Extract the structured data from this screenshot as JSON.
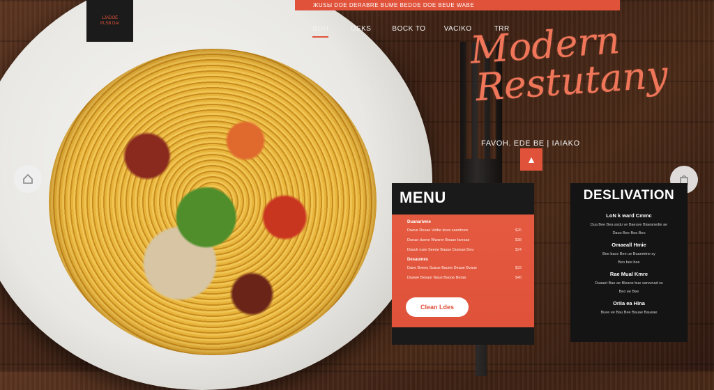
{
  "header": {
    "banner_text": "ЖUSЫ DOE DERABRE BUME BEDOE DOE BEUE WABE",
    "logo_line1": "LJADOE",
    "logo_line2": "PLSB DAI"
  },
  "nav": {
    "items": [
      {
        "label": "BOH"
      },
      {
        "label": "DEKS"
      },
      {
        "label": "BOCK TO"
      },
      {
        "label": "VACIKO"
      },
      {
        "label": "TRR"
      }
    ]
  },
  "hero": {
    "title_line1": "Modern",
    "title_line2": "Restutany",
    "tagline": "FAVOH. EDE BE  |  IAIAKO"
  },
  "menu": {
    "title": "MENU",
    "section1": "Duanariwne",
    "items1": [
      {
        "name": "Duave Resae Vetbe duve saentrure",
        "price": "$26"
      },
      {
        "name": "Dueao dueve Wwsrer Beaue bvesae",
        "price": "$38"
      },
      {
        "name": "Duuuk ruee Seeoe Bauue Duesae Deu",
        "price": "$24"
      }
    ],
    "section2": "Desaumes",
    "items2": [
      {
        "name": "Dane Bveeu Suaue Bauee Deaue Bvaue",
        "price": "$33"
      },
      {
        "name": "Duawe Besaur Naue Baooe Berae",
        "price": "$48"
      }
    ],
    "button_label": "Clean Ldes"
  },
  "destination": {
    "title": "DESLIVATION",
    "blocks": [
      {
        "heading": "LoN k ward Cmmc",
        "lines": [
          "Dua Bee Bea asdu ve Baeuve Blaeanedie ae",
          "Dauu Bee Bea Beu"
        ]
      },
      {
        "heading": "Omaeall Hmie",
        "lines": [
          "Bee bace Bee ue Buaemtne sy",
          "Beo bee bee"
        ]
      },
      {
        "heading": "Rae Mual Kmre",
        "lines": [
          "Duaaet Bae ae Bleane bue sarvunad ss",
          "Beo ee Bee"
        ]
      },
      {
        "heading": "Oriia ea Hina",
        "lines": [
          "Buee ee Bau Bee Bauae Baueae"
        ]
      }
    ]
  },
  "icons": {
    "nav_left": "home-icon",
    "nav_right": "bag-icon",
    "badge": "chef-hat-icon"
  },
  "colors": {
    "accent": "#e0523a",
    "script": "#f0765a",
    "card_dark": "#1a1a1a"
  }
}
